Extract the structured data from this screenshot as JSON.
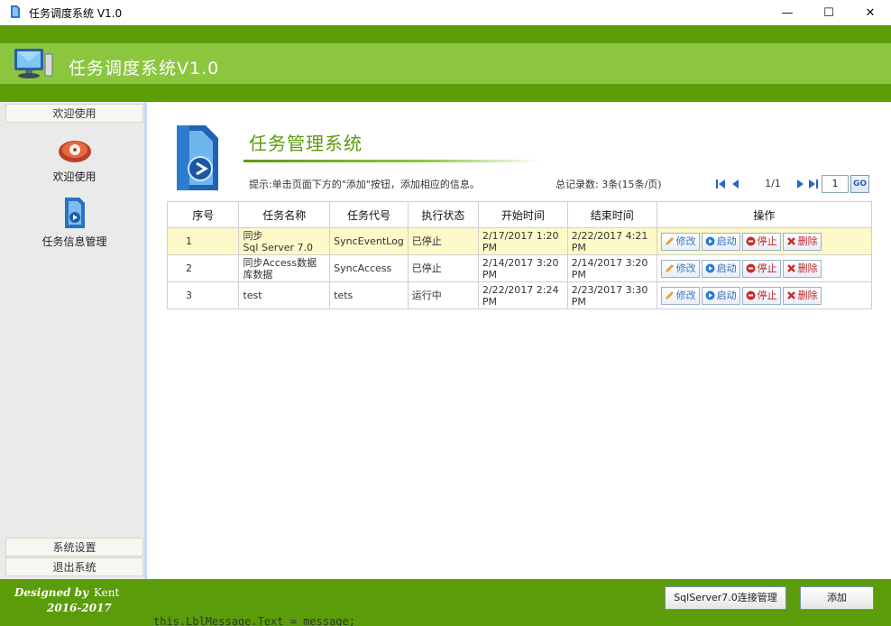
{
  "window": {
    "title": "任务调度系统 V1.0",
    "controls": {
      "minimize": "—",
      "maximize": "☐",
      "close": "✕"
    }
  },
  "header": {
    "title": "任务调度系统V1.0"
  },
  "sidebar": {
    "head": "欢迎使用",
    "items": [
      {
        "label": "欢迎使用",
        "icon": "welcome-icon"
      },
      {
        "label": "任务信息管理",
        "icon": "task-info-icon"
      }
    ],
    "footer_items": [
      {
        "label": "系统设置"
      },
      {
        "label": "退出系统"
      }
    ]
  },
  "main": {
    "title": "任务管理系统",
    "hint": "提示:单击页面下方的\"添加\"按钮，添加相应的信息。",
    "total": "总记录数: 3条(15条/页)",
    "pager": {
      "info": "1/1",
      "page_input": "1",
      "go": "GO"
    },
    "table": {
      "headers": [
        "序号",
        "任务名称",
        "任务代号",
        "执行状态",
        "开始时间",
        "结束时间",
        "操作"
      ],
      "rows": [
        {
          "no": "1",
          "name_line1": "同步",
          "name_line2": "Sql  Server  7.0",
          "code": "SyncEventLog",
          "status": "已停止",
          "start": "2/17/2017 1:20 PM",
          "end": "2/22/2017 4:21 PM"
        },
        {
          "no": "2",
          "name_line1": "同步Access数据",
          "name_line2": "库数据",
          "code": "SyncAccess",
          "status": "已停止",
          "start": "2/14/2017 3:20 PM",
          "end": "2/14/2017 3:20 PM"
        },
        {
          "no": "3",
          "name_line1": "test",
          "name_line2": "",
          "code": "tets",
          "status": "运行中",
          "start": "2/22/2017 2:24 PM",
          "end": "2/23/2017 3:30 PM"
        }
      ],
      "ops": {
        "edit": "修改",
        "start": "启动",
        "stop": "停止",
        "delete": "删除"
      }
    }
  },
  "footer": {
    "designed_by": "Designed by",
    "author": "Kent",
    "years": "2016-2017",
    "conn_button": "SqlServer7.0连接管理",
    "add_button": "添加",
    "code_fragment": "this.LblMessage.Text = message;"
  },
  "colors": {
    "green_dark": "#5b9c0a",
    "green_light": "#8cc63f",
    "selected_row": "#fdf9c8"
  }
}
